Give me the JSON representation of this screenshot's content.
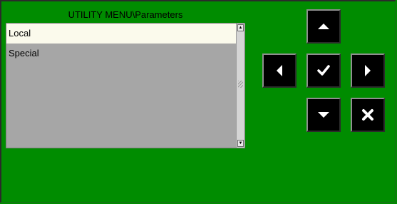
{
  "menu": {
    "title": "UTILITY MENU\\Parameters",
    "items": [
      {
        "label": "Local",
        "selected": true
      },
      {
        "label": "Special",
        "selected": false
      }
    ]
  },
  "scrollbar": {
    "up_glyph": "▲",
    "down_glyph": "▼"
  },
  "controls": {
    "up": "up-arrow-icon",
    "left": "left-arrow-icon",
    "ok": "checkmark-icon",
    "right": "right-arrow-icon",
    "down": "down-arrow-icon",
    "cancel": "cross-icon"
  },
  "colors": {
    "background": "#008c00",
    "selected_row": "#fbfaec",
    "list_background": "#a6a6a6",
    "button": "#000000",
    "icon": "#ffffff"
  }
}
